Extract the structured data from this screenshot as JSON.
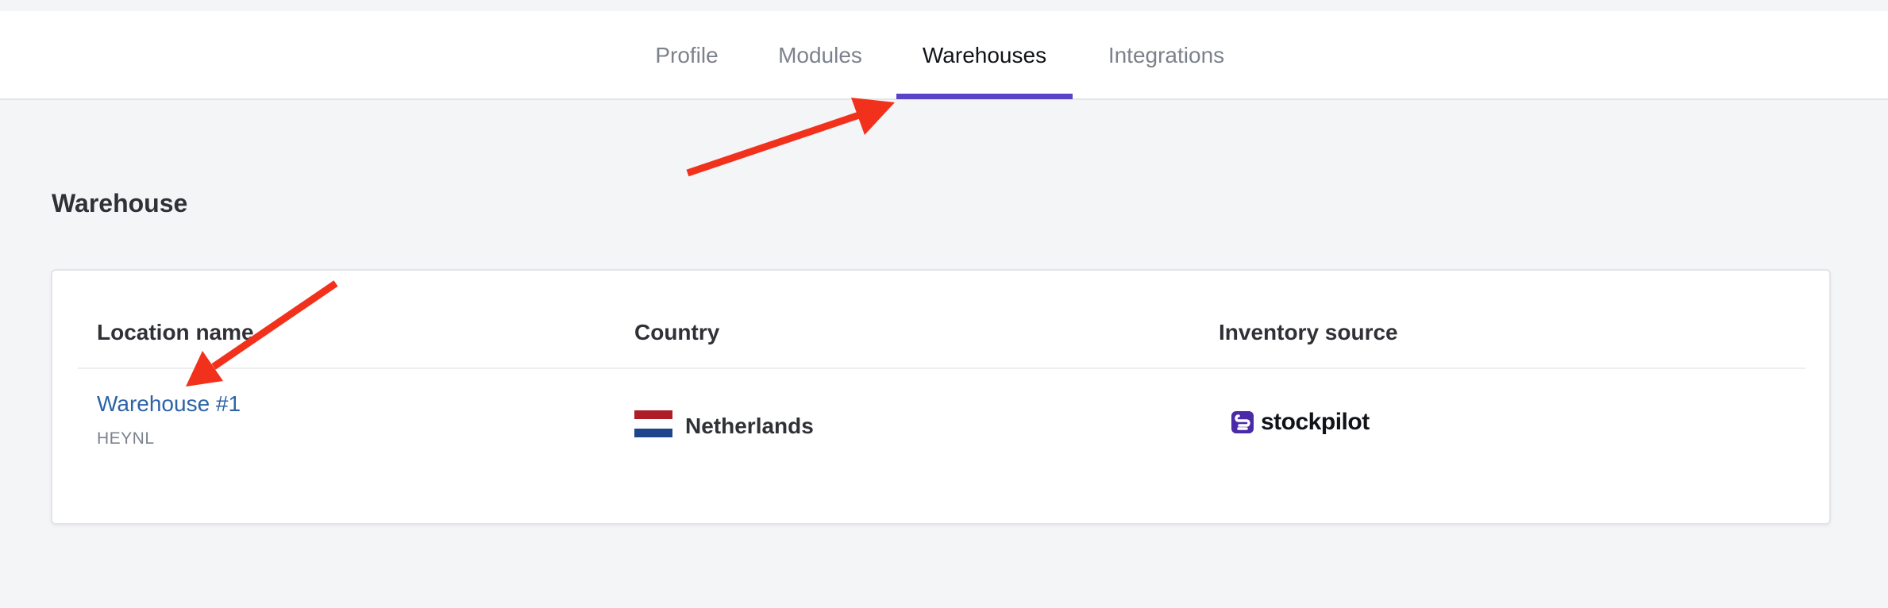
{
  "tabs": [
    {
      "label": "Profile",
      "active": false
    },
    {
      "label": "Modules",
      "active": false
    },
    {
      "label": "Warehouses",
      "active": true
    },
    {
      "label": "Integrations",
      "active": false
    }
  ],
  "section": {
    "title": "Warehouse"
  },
  "table": {
    "headers": {
      "location": "Location name",
      "country": "Country",
      "inventory": "Inventory source"
    },
    "rows": [
      {
        "location_name": "Warehouse #1",
        "location_code": "HEYNL",
        "country": "Netherlands",
        "inventory_source": "stockpilot"
      }
    ]
  },
  "colors": {
    "accent": "#5a43c9",
    "link": "#2d63a6",
    "annotation_arrow": "#f2311c",
    "flag_red": "#ad1d25",
    "flag_white": "#ffffff",
    "flag_blue": "#1e448a"
  },
  "icons": {
    "country_flag": "netherlands-flag-icon",
    "inventory_logo": "stockpilot-logo-icon"
  }
}
